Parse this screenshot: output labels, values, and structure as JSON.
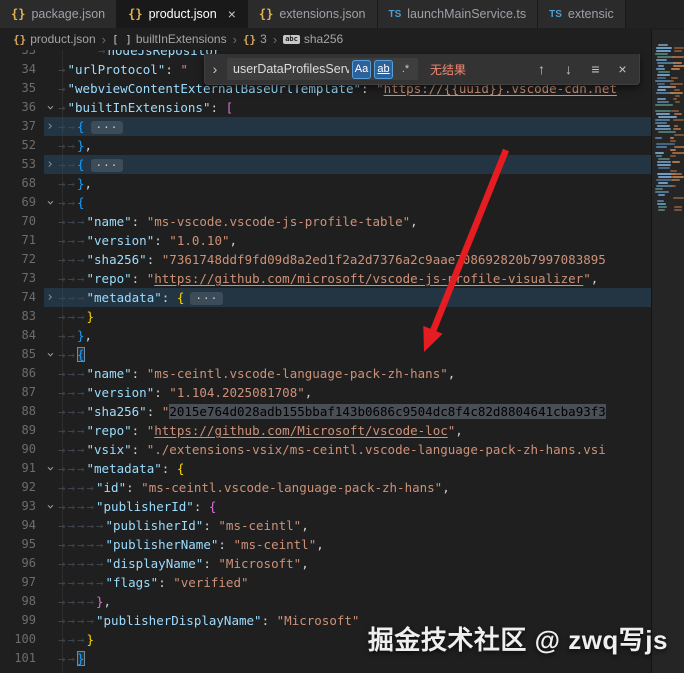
{
  "tabs": [
    {
      "kind": "json",
      "glyph": "{}",
      "label": "package.json",
      "active": false
    },
    {
      "kind": "json",
      "glyph": "{}",
      "label": "product.json",
      "active": true,
      "close_glyph": "×"
    },
    {
      "kind": "json",
      "glyph": "{}",
      "label": "extensions.json",
      "active": false
    },
    {
      "kind": "ts",
      "glyph": "TS",
      "label": "launchMainService.ts",
      "active": false
    },
    {
      "kind": "ts",
      "glyph": "TS",
      "label": "extensic",
      "active": false
    }
  ],
  "breadcrumb": {
    "separator": "›",
    "items": [
      {
        "kind": "obj",
        "glyph": "{}",
        "label": "product.json"
      },
      {
        "kind": "arr",
        "glyph": "[ ]",
        "label": "builtInExtensions"
      },
      {
        "kind": "obj",
        "glyph": "{}",
        "label": "3"
      },
      {
        "kind": "abc",
        "glyph": "abc",
        "label": "sha256"
      }
    ]
  },
  "find": {
    "toggle_icon": "›",
    "query": "userDataProfilesServ",
    "match_case_label": "Aa",
    "whole_word_label": "ab",
    "regex_label": ".*",
    "status": "无结果",
    "prev_icon": "↑",
    "next_icon": "↓",
    "selection_icon": "≡",
    "close_icon": "×"
  },
  "editor": {
    "lines": [
      {
        "n": "33",
        "ind": 1,
        "x": 40,
        "tok": [
          [
            "k",
            "nodeJsRepositor"
          ]
        ]
      },
      {
        "n": "34",
        "ind": 1,
        "tok": [
          [
            "k",
            "\"urlProtocol\""
          ],
          [
            "p",
            ": "
          ],
          [
            "s",
            "\""
          ]
        ]
      },
      {
        "n": "35",
        "ind": 1,
        "tok": [
          [
            "k",
            "\"webviewContentExternalBaseUrlTemplate\""
          ],
          [
            "p",
            ": "
          ],
          [
            "s",
            "\""
          ],
          [
            "l",
            "https://{{uuid}}.vscode-cdn.net"
          ]
        ]
      },
      {
        "n": "36",
        "fold": "d",
        "ind": 1,
        "tok": [
          [
            "k",
            "\"builtInExtensions\""
          ],
          [
            "p",
            ": "
          ],
          [
            "b2",
            "["
          ]
        ]
      },
      {
        "n": "37",
        "fold": "r",
        "ind": 2,
        "hl": true,
        "tok": [
          [
            "b3",
            "{"
          ],
          [
            "e",
            "···"
          ]
        ]
      },
      {
        "n": "52",
        "ind": 2,
        "tok": [
          [
            "b3",
            "}"
          ],
          [
            "p",
            ","
          ]
        ]
      },
      {
        "n": "53",
        "fold": "r",
        "ind": 2,
        "hl": true,
        "tok": [
          [
            "b3",
            "{"
          ],
          [
            "e",
            "···"
          ]
        ]
      },
      {
        "n": "68",
        "ind": 2,
        "tok": [
          [
            "b3",
            "}"
          ],
          [
            "p",
            ","
          ]
        ]
      },
      {
        "n": "69",
        "fold": "d",
        "ind": 2,
        "tok": [
          [
            "b3",
            "{"
          ]
        ]
      },
      {
        "n": "70",
        "ind": 3,
        "tok": [
          [
            "k",
            "\"name\""
          ],
          [
            "p",
            ": "
          ],
          [
            "s",
            "\"ms-vscode.vscode-js-profile-table\""
          ],
          [
            "p",
            ","
          ]
        ]
      },
      {
        "n": "71",
        "ind": 3,
        "tok": [
          [
            "k",
            "\"version\""
          ],
          [
            "p",
            ": "
          ],
          [
            "s",
            "\"1.0.10\""
          ],
          [
            "p",
            ","
          ]
        ]
      },
      {
        "n": "72",
        "ind": 3,
        "tok": [
          [
            "k",
            "\"sha256\""
          ],
          [
            "p",
            ": "
          ],
          [
            "s",
            "\"7361748ddf9fd09d8a2ed1f2a2d7376a2c9aae708692820b7997083895"
          ]
        ]
      },
      {
        "n": "73",
        "ind": 3,
        "tok": [
          [
            "k",
            "\"repo\""
          ],
          [
            "p",
            ": "
          ],
          [
            "s",
            "\""
          ],
          [
            "l",
            "https://github.com/microsoft/vscode-js-profile-visualizer"
          ],
          [
            "s",
            "\""
          ],
          [
            "p",
            ","
          ]
        ]
      },
      {
        "n": "74",
        "fold": "r",
        "ind": 3,
        "hl": true,
        "tok": [
          [
            "k",
            "\"metadata\""
          ],
          [
            "p",
            ": "
          ],
          [
            "b1",
            "{"
          ],
          [
            "e",
            "···"
          ]
        ]
      },
      {
        "n": "83",
        "ind": 3,
        "tok": [
          [
            "b1",
            "}"
          ]
        ]
      },
      {
        "n": "84",
        "ind": 2,
        "tok": [
          [
            "b3",
            "}"
          ],
          [
            "p",
            ","
          ]
        ]
      },
      {
        "n": "85",
        "fold": "d",
        "ind": 2,
        "tok": [
          [
            "b3m",
            "{"
          ]
        ]
      },
      {
        "n": "86",
        "ind": 3,
        "tok": [
          [
            "k",
            "\"name\""
          ],
          [
            "p",
            ": "
          ],
          [
            "s",
            "\"ms-ceintl.vscode-language-pack-zh-hans\""
          ],
          [
            "p",
            ","
          ]
        ]
      },
      {
        "n": "87",
        "ind": 3,
        "tok": [
          [
            "k",
            "\"version\""
          ],
          [
            "p",
            ": "
          ],
          [
            "s",
            "\"1.104.2025081708\""
          ],
          [
            "p",
            ","
          ]
        ]
      },
      {
        "n": "88",
        "ind": 3,
        "tok": [
          [
            "k",
            "\"sha256\""
          ],
          [
            "p",
            ": "
          ],
          [
            "s",
            "\""
          ],
          [
            "sel",
            "2015e764d028adb155bbaf143b0686c9504dc8f4c82d8804641cba93f3"
          ]
        ]
      },
      {
        "n": "89",
        "ind": 3,
        "tok": [
          [
            "k",
            "\"repo\""
          ],
          [
            "p",
            ": "
          ],
          [
            "s",
            "\""
          ],
          [
            "l",
            "https://github.com/Microsoft/vscode-loc"
          ],
          [
            "s",
            "\""
          ],
          [
            "p",
            ","
          ]
        ]
      },
      {
        "n": "90",
        "ind": 3,
        "tok": [
          [
            "k",
            "\"vsix\""
          ],
          [
            "p",
            ": "
          ],
          [
            "s",
            "\"./extensions-vsix/ms-ceintl.vscode-language-pack-zh-hans.vsi"
          ]
        ]
      },
      {
        "n": "91",
        "fold": "d",
        "ind": 3,
        "tok": [
          [
            "k",
            "\"metadata\""
          ],
          [
            "p",
            ": "
          ],
          [
            "b1",
            "{"
          ]
        ]
      },
      {
        "n": "92",
        "ind": 4,
        "tok": [
          [
            "k",
            "\"id\""
          ],
          [
            "p",
            ": "
          ],
          [
            "s",
            "\"ms-ceintl.vscode-language-pack-zh-hans\""
          ],
          [
            "p",
            ","
          ]
        ]
      },
      {
        "n": "93",
        "fold": "d",
        "ind": 4,
        "tok": [
          [
            "k",
            "\"publisherId\""
          ],
          [
            "p",
            ": "
          ],
          [
            "b2",
            "{"
          ]
        ]
      },
      {
        "n": "94",
        "ind": 5,
        "tok": [
          [
            "k",
            "\"publisherId\""
          ],
          [
            "p",
            ": "
          ],
          [
            "s",
            "\"ms-ceintl\""
          ],
          [
            "p",
            ","
          ]
        ]
      },
      {
        "n": "95",
        "ind": 5,
        "tok": [
          [
            "k",
            "\"publisherName\""
          ],
          [
            "p",
            ": "
          ],
          [
            "s",
            "\"ms-ceintl\""
          ],
          [
            "p",
            ","
          ]
        ]
      },
      {
        "n": "96",
        "ind": 5,
        "tok": [
          [
            "k",
            "\"displayName\""
          ],
          [
            "p",
            ": "
          ],
          [
            "s",
            "\"Microsoft\""
          ],
          [
            "p",
            ","
          ]
        ]
      },
      {
        "n": "97",
        "ind": 5,
        "tok": [
          [
            "k",
            "\"flags\""
          ],
          [
            "p",
            ": "
          ],
          [
            "s",
            "\"verified\""
          ]
        ]
      },
      {
        "n": "98",
        "ind": 4,
        "tok": [
          [
            "b2",
            "}"
          ],
          [
            "p",
            ","
          ]
        ]
      },
      {
        "n": "99",
        "ind": 4,
        "tok": [
          [
            "k",
            "\"publisherDisplayName\""
          ],
          [
            "p",
            ": "
          ],
          [
            "s",
            "\"Microsoft\""
          ]
        ]
      },
      {
        "n": "100",
        "ind": 3,
        "tok": [
          [
            "b1",
            "}"
          ]
        ]
      },
      {
        "n": "101",
        "ind": 2,
        "tok": [
          [
            "b3m",
            "}"
          ]
        ]
      }
    ]
  },
  "watermark": {
    "text": "掘金技术社区 @ zwq写js"
  },
  "colors": {
    "status_no_results": "#f48771",
    "find_option_active": "#2f6098",
    "annotation_arrow": "#e51d22",
    "link": "#ce9178",
    "key": "#9cdcfe",
    "string": "#ce9178"
  }
}
